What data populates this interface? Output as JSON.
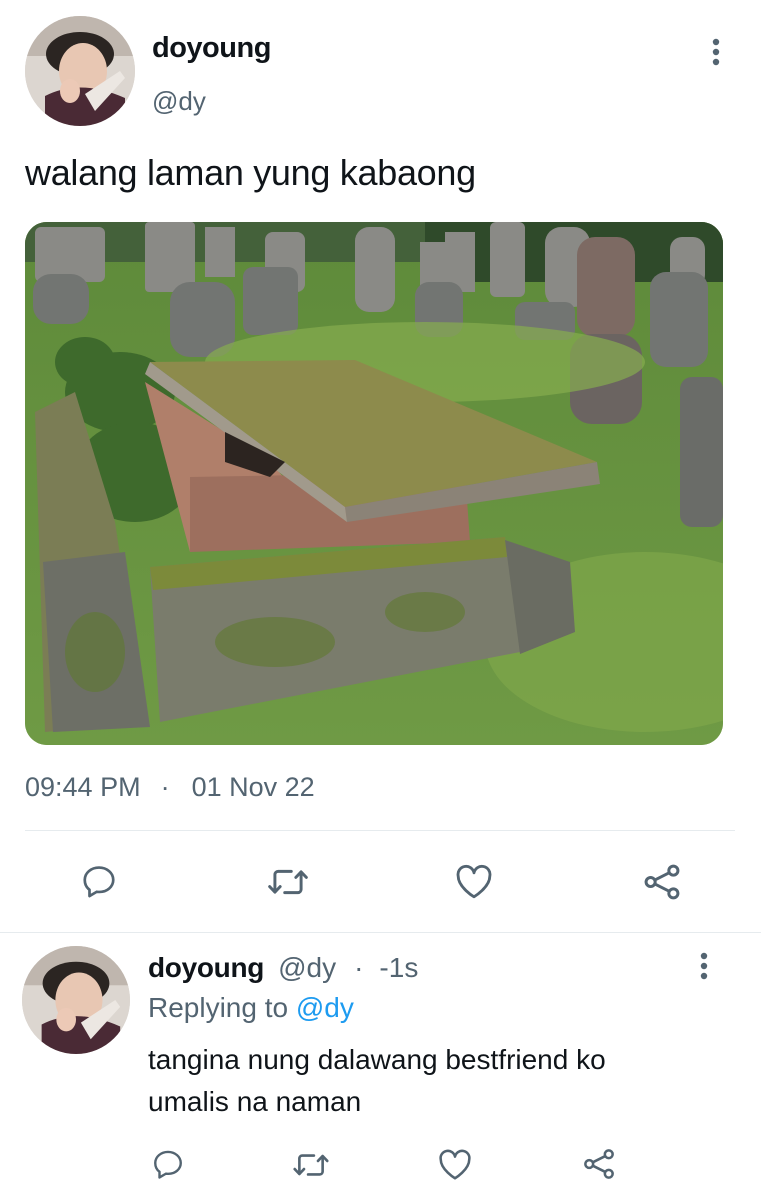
{
  "tweet": {
    "display_name": "doyoung",
    "handle": "@dy",
    "text": "walang laman yung kabaong",
    "time": "09:44 PM",
    "separator": "·",
    "date": "01 Nov 22"
  },
  "actions": [
    "reply-icon",
    "retweet-icon",
    "like-icon",
    "share-icon"
  ],
  "reply": {
    "display_name": "doyoung",
    "handle": "@dy",
    "separator": "·",
    "age": "-1s",
    "replying_prefix": "Replying to",
    "replying_handle": "@dy",
    "text_line1": "tangina nung dalawang bestfriend ko",
    "text_line2": "umalis na naman"
  },
  "colors": {
    "link": "#1d9bf0",
    "muted": "#536471",
    "icon": "#536471"
  }
}
